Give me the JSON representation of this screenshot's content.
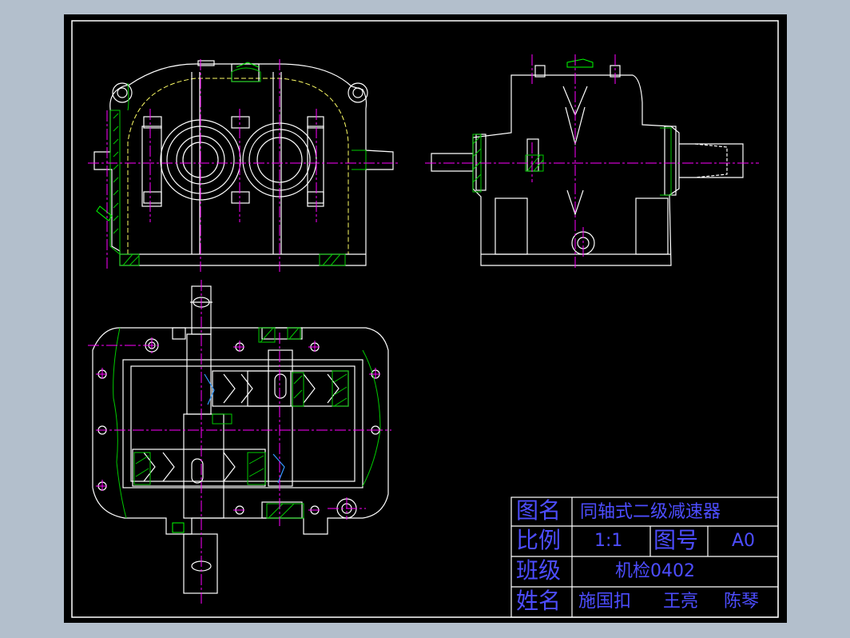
{
  "colors": {
    "background": "#b3bfcc",
    "drawing": "#000000",
    "outline": "#ffffff",
    "centerline": "#ff00ff",
    "hatch": "#00cc00",
    "hidden": "#ffff66",
    "text": "#4d4dff",
    "section": "#3399ff"
  },
  "title_block": {
    "name_label": "图名",
    "name_value": "同轴式二级减速器",
    "scale_label": "比例",
    "scale_value": "1:1",
    "drawing_no_label": "图号",
    "drawing_no_value": "A0",
    "class_label": "班级",
    "class_value": "机检0402",
    "student_label": "姓名",
    "students": [
      "施国扣",
      "王亮",
      "陈琴"
    ]
  },
  "views": {
    "front": "front-view",
    "side": "side-view",
    "top": "top-view"
  }
}
